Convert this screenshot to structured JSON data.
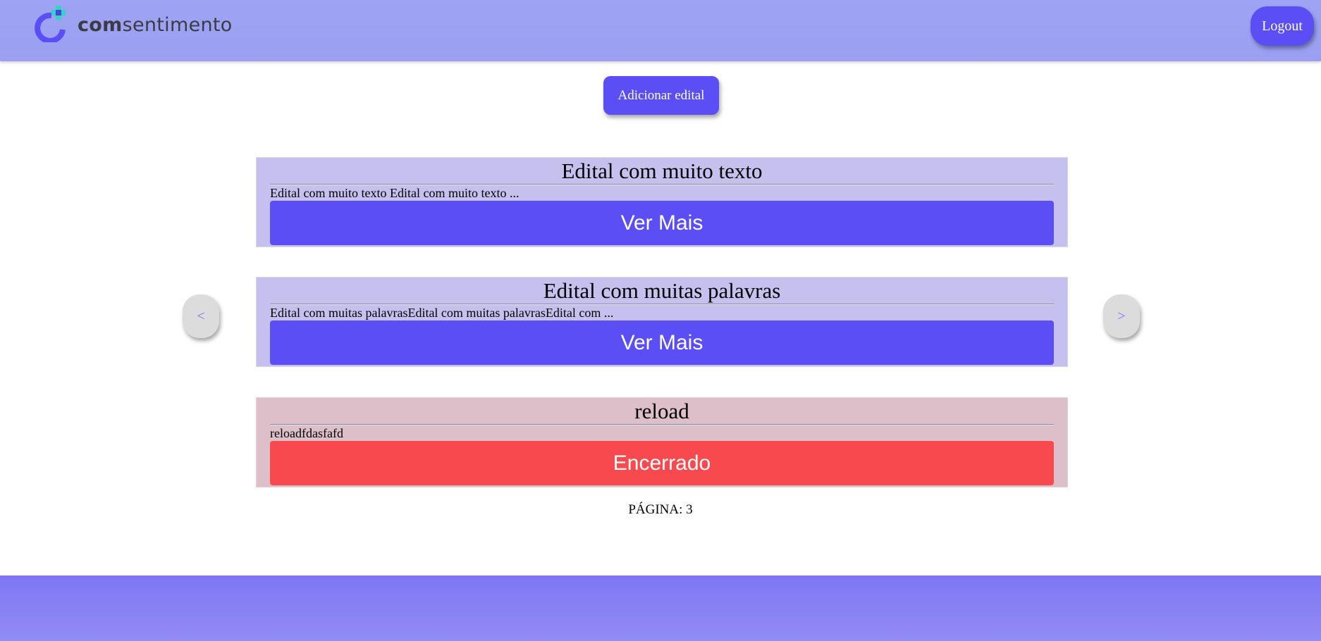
{
  "header": {
    "brand_bold": "com",
    "brand_light": "sentimento",
    "logout_label": "Logout"
  },
  "actions": {
    "add_label": "Adicionar edital"
  },
  "cards": [
    {
      "title": "Edital com muito texto",
      "description": "Edital com muito texto Edital com muito texto ...",
      "button_label": "Ver Mais",
      "status": "open"
    },
    {
      "title": "Edital com muitas palavras",
      "description": "Edital com muitas palavrasEdital com muitas palavrasEdital com ...",
      "button_label": "Ver Mais",
      "status": "open"
    },
    {
      "title": "reload",
      "description": "reloadfdasfafd",
      "button_label": "Encerrado",
      "status": "closed"
    }
  ],
  "pagination": {
    "prev_label": "<",
    "next_label": ">",
    "page_text": "PÁGINA: 3"
  },
  "colors": {
    "accent": "#5b4ef5",
    "closed": "#f84a4e",
    "header_bg": "#9ea3f3",
    "card_bg": "#c6c0ee",
    "card_closed_bg": "#dcbfc8",
    "logo_teal": "#2fd6c6"
  },
  "icons": {
    "logo": "comsentimento-logo-icon"
  }
}
